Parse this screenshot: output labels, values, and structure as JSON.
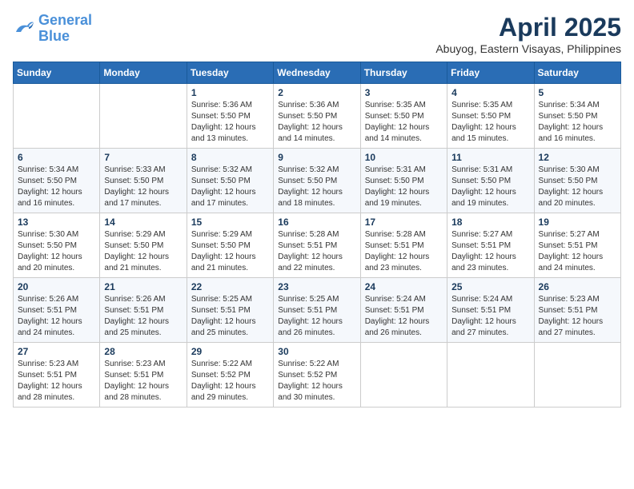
{
  "header": {
    "logo_line1": "General",
    "logo_line2": "Blue",
    "month": "April 2025",
    "location": "Abuyog, Eastern Visayas, Philippines"
  },
  "weekdays": [
    "Sunday",
    "Monday",
    "Tuesday",
    "Wednesday",
    "Thursday",
    "Friday",
    "Saturday"
  ],
  "weeks": [
    [
      {
        "day": "",
        "info": ""
      },
      {
        "day": "",
        "info": ""
      },
      {
        "day": "1",
        "info": "Sunrise: 5:36 AM\nSunset: 5:50 PM\nDaylight: 12 hours and 13 minutes."
      },
      {
        "day": "2",
        "info": "Sunrise: 5:36 AM\nSunset: 5:50 PM\nDaylight: 12 hours and 14 minutes."
      },
      {
        "day": "3",
        "info": "Sunrise: 5:35 AM\nSunset: 5:50 PM\nDaylight: 12 hours and 14 minutes."
      },
      {
        "day": "4",
        "info": "Sunrise: 5:35 AM\nSunset: 5:50 PM\nDaylight: 12 hours and 15 minutes."
      },
      {
        "day": "5",
        "info": "Sunrise: 5:34 AM\nSunset: 5:50 PM\nDaylight: 12 hours and 16 minutes."
      }
    ],
    [
      {
        "day": "6",
        "info": "Sunrise: 5:34 AM\nSunset: 5:50 PM\nDaylight: 12 hours and 16 minutes."
      },
      {
        "day": "7",
        "info": "Sunrise: 5:33 AM\nSunset: 5:50 PM\nDaylight: 12 hours and 17 minutes."
      },
      {
        "day": "8",
        "info": "Sunrise: 5:32 AM\nSunset: 5:50 PM\nDaylight: 12 hours and 17 minutes."
      },
      {
        "day": "9",
        "info": "Sunrise: 5:32 AM\nSunset: 5:50 PM\nDaylight: 12 hours and 18 minutes."
      },
      {
        "day": "10",
        "info": "Sunrise: 5:31 AM\nSunset: 5:50 PM\nDaylight: 12 hours and 19 minutes."
      },
      {
        "day": "11",
        "info": "Sunrise: 5:31 AM\nSunset: 5:50 PM\nDaylight: 12 hours and 19 minutes."
      },
      {
        "day": "12",
        "info": "Sunrise: 5:30 AM\nSunset: 5:50 PM\nDaylight: 12 hours and 20 minutes."
      }
    ],
    [
      {
        "day": "13",
        "info": "Sunrise: 5:30 AM\nSunset: 5:50 PM\nDaylight: 12 hours and 20 minutes."
      },
      {
        "day": "14",
        "info": "Sunrise: 5:29 AM\nSunset: 5:50 PM\nDaylight: 12 hours and 21 minutes."
      },
      {
        "day": "15",
        "info": "Sunrise: 5:29 AM\nSunset: 5:50 PM\nDaylight: 12 hours and 21 minutes."
      },
      {
        "day": "16",
        "info": "Sunrise: 5:28 AM\nSunset: 5:51 PM\nDaylight: 12 hours and 22 minutes."
      },
      {
        "day": "17",
        "info": "Sunrise: 5:28 AM\nSunset: 5:51 PM\nDaylight: 12 hours and 23 minutes."
      },
      {
        "day": "18",
        "info": "Sunrise: 5:27 AM\nSunset: 5:51 PM\nDaylight: 12 hours and 23 minutes."
      },
      {
        "day": "19",
        "info": "Sunrise: 5:27 AM\nSunset: 5:51 PM\nDaylight: 12 hours and 24 minutes."
      }
    ],
    [
      {
        "day": "20",
        "info": "Sunrise: 5:26 AM\nSunset: 5:51 PM\nDaylight: 12 hours and 24 minutes."
      },
      {
        "day": "21",
        "info": "Sunrise: 5:26 AM\nSunset: 5:51 PM\nDaylight: 12 hours and 25 minutes."
      },
      {
        "day": "22",
        "info": "Sunrise: 5:25 AM\nSunset: 5:51 PM\nDaylight: 12 hours and 25 minutes."
      },
      {
        "day": "23",
        "info": "Sunrise: 5:25 AM\nSunset: 5:51 PM\nDaylight: 12 hours and 26 minutes."
      },
      {
        "day": "24",
        "info": "Sunrise: 5:24 AM\nSunset: 5:51 PM\nDaylight: 12 hours and 26 minutes."
      },
      {
        "day": "25",
        "info": "Sunrise: 5:24 AM\nSunset: 5:51 PM\nDaylight: 12 hours and 27 minutes."
      },
      {
        "day": "26",
        "info": "Sunrise: 5:23 AM\nSunset: 5:51 PM\nDaylight: 12 hours and 27 minutes."
      }
    ],
    [
      {
        "day": "27",
        "info": "Sunrise: 5:23 AM\nSunset: 5:51 PM\nDaylight: 12 hours and 28 minutes."
      },
      {
        "day": "28",
        "info": "Sunrise: 5:23 AM\nSunset: 5:51 PM\nDaylight: 12 hours and 28 minutes."
      },
      {
        "day": "29",
        "info": "Sunrise: 5:22 AM\nSunset: 5:52 PM\nDaylight: 12 hours and 29 minutes."
      },
      {
        "day": "30",
        "info": "Sunrise: 5:22 AM\nSunset: 5:52 PM\nDaylight: 12 hours and 30 minutes."
      },
      {
        "day": "",
        "info": ""
      },
      {
        "day": "",
        "info": ""
      },
      {
        "day": "",
        "info": ""
      }
    ]
  ]
}
